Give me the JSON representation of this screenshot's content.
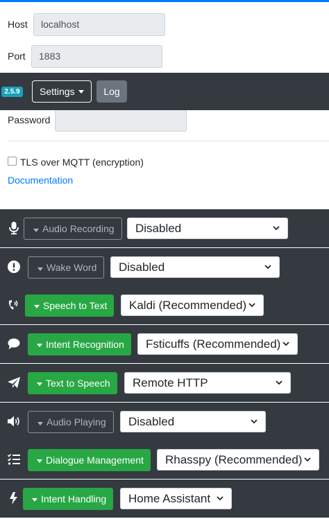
{
  "mqtt": {
    "host_label": "Host",
    "host_value": "localhost",
    "port_label": "Port",
    "port_value": "1883",
    "password_label": "Password",
    "password_value": "",
    "tls_label": "TLS over MQTT (encryption)",
    "tls_checked": false,
    "documentation_link": "Documentation"
  },
  "navbar": {
    "version": "2.5.9",
    "settings_label": "Settings",
    "log_label": "Log"
  },
  "services": [
    {
      "icon": "microphone-icon",
      "label": "Audio Recording",
      "enabled": false,
      "value": "Disabled"
    },
    {
      "icon": "exclamation-icon",
      "label": "Wake Word",
      "enabled": false,
      "value": "Disabled"
    },
    {
      "icon": "phone-volume-icon",
      "label": "Speech to Text",
      "enabled": true,
      "value": "Kaldi (Recommended)"
    },
    {
      "icon": "comment-icon",
      "label": "Intent Recognition",
      "enabled": true,
      "value": "Fsticuffs (Recommended)"
    },
    {
      "icon": "paper-plane-icon",
      "label": "Text to Speech",
      "enabled": true,
      "value": "Remote HTTP"
    },
    {
      "icon": "volume-up-icon",
      "label": "Audio Playing",
      "enabled": false,
      "value": "Disabled"
    },
    {
      "icon": "tasks-icon",
      "label": "Dialogue Management",
      "enabled": true,
      "value": "Rhasspy (Recommended)"
    },
    {
      "icon": "bolt-icon",
      "label": "Intent Handling",
      "enabled": true,
      "value": "Home Assistant"
    }
  ],
  "colors": {
    "navbar": "#343a40",
    "enabled_button": "#28a745",
    "badge": "#17a2b8",
    "link": "#007bff"
  }
}
